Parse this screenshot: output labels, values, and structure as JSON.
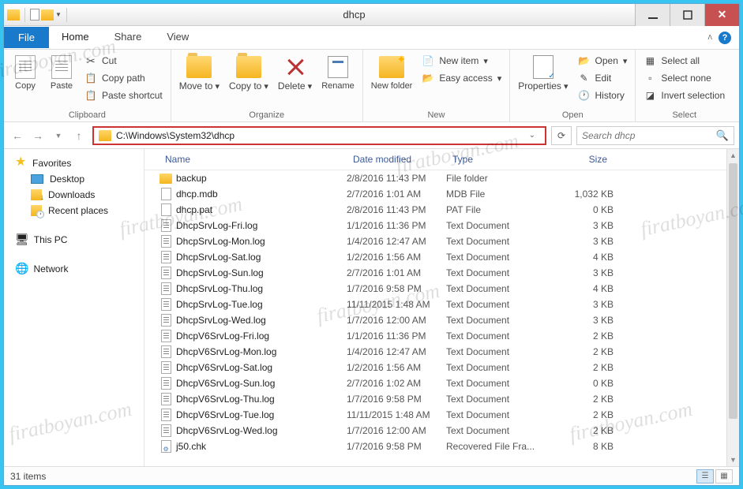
{
  "window_title": "dhcp",
  "tabs": {
    "file": "File",
    "home": "Home",
    "share": "Share",
    "view": "View"
  },
  "ribbon": {
    "clipboard": {
      "label": "Clipboard",
      "copy": "Copy",
      "paste": "Paste",
      "cut": "Cut",
      "copy_path": "Copy path",
      "paste_shortcut": "Paste shortcut"
    },
    "organize": {
      "label": "Organize",
      "move_to": "Move to",
      "copy_to": "Copy to",
      "delete": "Delete",
      "rename": "Rename"
    },
    "new": {
      "label": "New",
      "new_folder": "New folder",
      "new_item": "New item",
      "easy_access": "Easy access"
    },
    "open": {
      "label": "Open",
      "properties": "Properties",
      "open": "Open",
      "edit": "Edit",
      "history": "History"
    },
    "select": {
      "label": "Select",
      "select_all": "Select all",
      "select_none": "Select none",
      "invert": "Invert selection"
    }
  },
  "address": "C:\\Windows\\System32\\dhcp",
  "search_placeholder": "Search dhcp",
  "sidebar": {
    "favorites": "Favorites",
    "desktop": "Desktop",
    "downloads": "Downloads",
    "recent": "Recent places",
    "this_pc": "This PC",
    "network": "Network"
  },
  "columns": {
    "name": "Name",
    "date": "Date modified",
    "type": "Type",
    "size": "Size"
  },
  "files": [
    {
      "ico": "folder",
      "name": "backup",
      "date": "2/8/2016 11:43 PM",
      "type": "File folder",
      "size": ""
    },
    {
      "ico": "file",
      "name": "dhcp.mdb",
      "date": "2/7/2016 1:01 AM",
      "type": "MDB File",
      "size": "1,032 KB"
    },
    {
      "ico": "file",
      "name": "dhcp.pat",
      "date": "2/8/2016 11:43 PM",
      "type": "PAT File",
      "size": "0 KB"
    },
    {
      "ico": "txt",
      "name": "DhcpSrvLog-Fri.log",
      "date": "1/1/2016 11:36 PM",
      "type": "Text Document",
      "size": "3 KB"
    },
    {
      "ico": "txt",
      "name": "DhcpSrvLog-Mon.log",
      "date": "1/4/2016 12:47 AM",
      "type": "Text Document",
      "size": "3 KB"
    },
    {
      "ico": "txt",
      "name": "DhcpSrvLog-Sat.log",
      "date": "1/2/2016 1:56 AM",
      "type": "Text Document",
      "size": "4 KB"
    },
    {
      "ico": "txt",
      "name": "DhcpSrvLog-Sun.log",
      "date": "2/7/2016 1:01 AM",
      "type": "Text Document",
      "size": "3 KB"
    },
    {
      "ico": "txt",
      "name": "DhcpSrvLog-Thu.log",
      "date": "1/7/2016 9:58 PM",
      "type": "Text Document",
      "size": "4 KB"
    },
    {
      "ico": "txt",
      "name": "DhcpSrvLog-Tue.log",
      "date": "11/11/2015 1:48 AM",
      "type": "Text Document",
      "size": "3 KB"
    },
    {
      "ico": "txt",
      "name": "DhcpSrvLog-Wed.log",
      "date": "1/7/2016 12:00 AM",
      "type": "Text Document",
      "size": "3 KB"
    },
    {
      "ico": "txt",
      "name": "DhcpV6SrvLog-Fri.log",
      "date": "1/1/2016 11:36 PM",
      "type": "Text Document",
      "size": "2 KB"
    },
    {
      "ico": "txt",
      "name": "DhcpV6SrvLog-Mon.log",
      "date": "1/4/2016 12:47 AM",
      "type": "Text Document",
      "size": "2 KB"
    },
    {
      "ico": "txt",
      "name": "DhcpV6SrvLog-Sat.log",
      "date": "1/2/2016 1:56 AM",
      "type": "Text Document",
      "size": "2 KB"
    },
    {
      "ico": "txt",
      "name": "DhcpV6SrvLog-Sun.log",
      "date": "2/7/2016 1:02 AM",
      "type": "Text Document",
      "size": "0 KB"
    },
    {
      "ico": "txt",
      "name": "DhcpV6SrvLog-Thu.log",
      "date": "1/7/2016 9:58 PM",
      "type": "Text Document",
      "size": "2 KB"
    },
    {
      "ico": "txt",
      "name": "DhcpV6SrvLog-Tue.log",
      "date": "11/11/2015 1:48 AM",
      "type": "Text Document",
      "size": "2 KB"
    },
    {
      "ico": "txt",
      "name": "DhcpV6SrvLog-Wed.log",
      "date": "1/7/2016 12:00 AM",
      "type": "Text Document",
      "size": "2 KB"
    },
    {
      "ico": "chk",
      "name": "j50.chk",
      "date": "1/7/2016 9:58 PM",
      "type": "Recovered File Fra...",
      "size": "8 KB"
    }
  ],
  "status": "31 items",
  "watermark": "firatboyan.com"
}
